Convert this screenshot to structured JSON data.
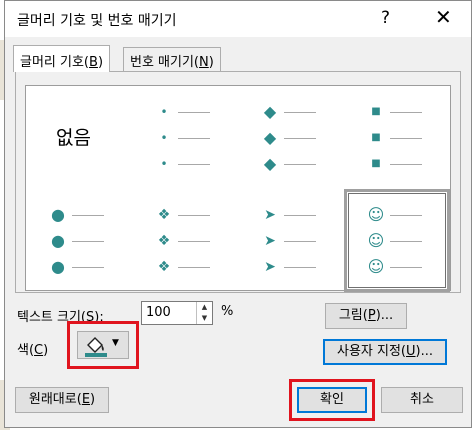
{
  "dialog": {
    "title": "글머리 기호 및 번호 매기기",
    "help_label": "?",
    "close_label": "✕"
  },
  "tabs": [
    {
      "label": "글머리 기호(",
      "key": "B",
      "suffix": ")"
    },
    {
      "label": "번호 매기기(",
      "key": "N",
      "suffix": ")"
    }
  ],
  "bullets": {
    "none_label": "없음",
    "styles": [
      {
        "name": "small-dot",
        "glyph": "•"
      },
      {
        "name": "diamond",
        "glyph": "◆"
      },
      {
        "name": "square",
        "glyph": "■"
      },
      {
        "name": "round-dot",
        "glyph": "●"
      },
      {
        "name": "four-diamond",
        "glyph": "❖"
      },
      {
        "name": "arrowhead",
        "glyph": "➤"
      },
      {
        "name": "smiley",
        "glyph": "☺"
      }
    ]
  },
  "size": {
    "label": "텍스트 크기(",
    "key": "S",
    "suffix": "):",
    "value": "100",
    "unit": "%",
    "up_label": "▲",
    "down_label": "▼"
  },
  "color": {
    "label": "색(",
    "key": "C",
    "suffix": ")",
    "swatch": "#2e8b8b",
    "dropdown_label": "▼"
  },
  "buttons": {
    "picture": {
      "label": "그림(",
      "key": "P",
      "suffix": ")..."
    },
    "custom": {
      "label": "사용자 지정(",
      "key": "U",
      "suffix": ")..."
    },
    "reset": {
      "label": "원래대로(",
      "key": "E",
      "suffix": ")"
    },
    "ok": "확인",
    "cancel": "취소"
  },
  "colors": {
    "bullet": "#2e8b8b",
    "highlight": "#e0141e",
    "accent": "#0078d7"
  }
}
